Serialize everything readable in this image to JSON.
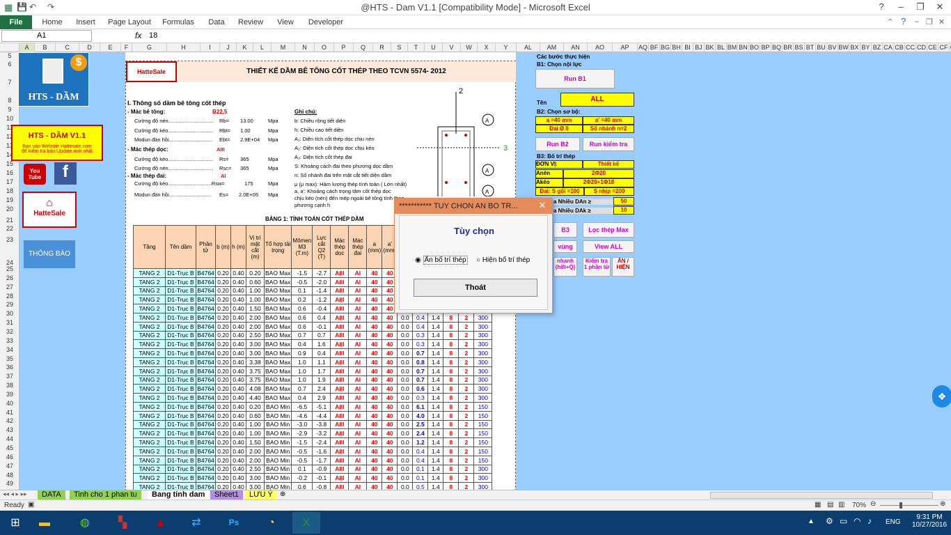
{
  "window": {
    "title": "@HTS - Dam V1.1  [Compatibility Mode] - Microsoft Excel"
  },
  "ribbon": {
    "file": "File",
    "tabs": [
      "Home",
      "Insert",
      "Page Layout",
      "Formulas",
      "Data",
      "Review",
      "View",
      "Developer"
    ]
  },
  "formula": {
    "cell": "A1",
    "fx": "fx",
    "value": "18"
  },
  "columns": [
    "A",
    "B",
    "C",
    "D",
    "E",
    "F",
    "G",
    "H",
    "I",
    "J",
    "K",
    "L",
    "M",
    "N",
    "O",
    "P",
    "Q",
    "R",
    "S",
    "T",
    "U",
    "V",
    "W",
    "X",
    "Y",
    "AL",
    "AM",
    "AN",
    "AO",
    "AP",
    "AQ",
    "BF",
    "BG",
    "BH",
    "BI",
    "BJ",
    "BK",
    "BL",
    "BM",
    "BN",
    "BO",
    "BP",
    "BQ",
    "BR",
    "BS",
    "BT",
    "BU",
    "BV",
    "BW",
    "BX",
    "BY",
    "BZ",
    "CA",
    "CB",
    "CC",
    "CD",
    "CE",
    "CF",
    "CG"
  ],
  "left": {
    "logo": "HTS - DẦM",
    "version": "HTS - DẦM V1.1",
    "note1": "Bạn vào Webstie Hattesale.com",
    "note2": "để kiểm tra bản Update mới nhất",
    "youtube": "You Tube",
    "fb": "f",
    "hatte": "HatteSale",
    "notice": "THÔNG BÁO"
  },
  "sheet": {
    "header_logo": "HatteSale",
    "title": "THIẾT KẾ DẦM BÊ TÔNG CỐT THÉP THEO TCVN 5574- 2012",
    "sec1": "I. Thông số dầm bê tông cốt thép",
    "concrete_label": "- Mác bê tông:",
    "concrete_val": "B22,5",
    "rb": "Cường độ nén...............................",
    "rb_k": "Rb=",
    "rb_v": "13.00",
    "rb_u": "Mpa",
    "rbt": "Cường độ kéo...............................",
    "rbt_k": "Rbt=",
    "rbt_v": "1.00",
    "rbt_u": "Mpa",
    "eb": "Modun đàn hồi..............................",
    "eb_k": "Ebt=",
    "eb_v": "2.9E+04",
    "eb_u": "Mpa",
    "long_label": "- Mác thép dọc:",
    "long_val": "AIII",
    "rs": "Cường độ kéo...............................",
    "rs_k": "Rs=",
    "rs_v": "365",
    "rs_u": "Mpa",
    "rsc": "Cường độ nén...............................",
    "rsc_k": "Rsc=",
    "rsc_v": "365",
    "rsc_u": "Mpa",
    "stir_label": "- Mác thép đai:",
    "stir_val": "AI",
    "rsw": "Cường độ kéo..............................Rsw=",
    "rsw_v": "175",
    "rsw_u": "Mpa",
    "es": "Modun đàn hồi.............................",
    "es_k": "Es=",
    "es_v": "2.0E+05",
    "es_u": "Mpa",
    "note_title": "Ghi chú:",
    "notes": [
      "b: Chiều rộng tiết diện",
      "h: Chiều cao tiết diện",
      "A₁: Diện tích cốt thép dọc chịu nén",
      "A₂: Diện tích cốt thép dọc chịu kéo",
      "A₃: Diện tích cốt thép đai",
      "S: Khoảng cách đai theo phương dọc dầm",
      "n: Số nhánh đai trên mặt cắt tiết diện dầm",
      "μ (μ max): Hàm lượng thép tính toán ( Lớn nhất)",
      "a, a': Khoảng cách trọng tâm cốt thép dọc",
      "chịu kéo (nén)  đến mép ngoài bê tông tính theo",
      "phương cạnh h"
    ],
    "table_title": "BẢNG 1: TÍNH TOÁN CỐT THÉP DẦM",
    "headers": [
      "Tầng",
      "Tên dầm",
      "Phần tử",
      "b (m)",
      "h (m)",
      "Vị trí mặt cắt (m)",
      "Tổ hợp tải trọng",
      "Mômen M3 (T.m)",
      "Lực cắt Q2 (T)",
      "Mác thép dọc",
      "Mác thép đai",
      "a (mm)",
      "a' (mm)",
      "",
      "",
      "",
      "",
      "",
      ""
    ]
  },
  "rows": [
    [
      "24",
      "",
      "",
      "",
      "",
      "",
      "",
      "",
      "",
      "",
      "",
      "",
      "",
      "",
      "",
      "",
      "",
      "",
      ""
    ],
    [
      "25",
      "TANG 2",
      "D1-Trục B",
      "B4764",
      "0.20",
      "0.40",
      "0.20",
      "BAO Max",
      "-1.5",
      "-2.7",
      "AIII",
      "AI",
      "40",
      "40",
      "0.0",
      "0.4",
      "1.4",
      "8",
      "2",
      "300"
    ],
    [
      "26",
      "TANG 2",
      "D1-Trục B",
      "B4764",
      "0.20",
      "0.40",
      "0.60",
      "BAO Max",
      "-0.5",
      "-2.0",
      "AIII",
      "AI",
      "40",
      "40",
      "0.0",
      "0.4",
      "1.4",
      "8",
      "2",
      "300"
    ],
    [
      "27",
      "TANG 2",
      "D1-Trục B",
      "B4764",
      "0.20",
      "0.40",
      "1.00",
      "BAO Max",
      "0.1",
      "-1.4",
      "AIII",
      "AI",
      "40",
      "40",
      "0.0",
      "0.4",
      "1.4",
      "8",
      "2",
      "300"
    ],
    [
      "28",
      "TANG 2",
      "D1-Trục B",
      "B4764",
      "0.20",
      "0.40",
      "1.00",
      "BAO Max",
      "0.2",
      "-1.2",
      "AIII",
      "AI",
      "40",
      "40",
      "0.0",
      "0.4",
      "1.4",
      "8",
      "2",
      "300"
    ],
    [
      "29",
      "TANG 2",
      "D1-Trục B",
      "B4764",
      "0.20",
      "0.40",
      "1.50",
      "BAO Max",
      "0.6",
      "-0.4",
      "AIII",
      "AI",
      "40",
      "40",
      "0.0",
      "0.4",
      "1.4",
      "8",
      "2",
      "300"
    ],
    [
      "30",
      "TANG 2",
      "D1-Trục B",
      "B4764",
      "0.20",
      "0.40",
      "2.00",
      "BAO Max",
      "0.6",
      "0.4",
      "AIII",
      "AI",
      "40",
      "40",
      "0.0",
      "0.4",
      "1.4",
      "8",
      "2",
      "300"
    ],
    [
      "31",
      "TANG 2",
      "D1-Trục B",
      "B4764",
      "0.20",
      "0.40",
      "2.00",
      "BAO Max",
      "0.6",
      "-0.1",
      "AIII",
      "AI",
      "40",
      "40",
      "0.0",
      "0.4",
      "1.4",
      "8",
      "2",
      "300"
    ],
    [
      "32",
      "TANG 2",
      "D1-Trục B",
      "B4764",
      "0.20",
      "0.40",
      "2.50",
      "BAO Max",
      "0.7",
      "0.7",
      "AIII",
      "AI",
      "40",
      "40",
      "0.0",
      "0.3",
      "1.4",
      "8",
      "2",
      "300"
    ],
    [
      "33",
      "TANG 2",
      "D1-Trục B",
      "B4764",
      "0.20",
      "0.40",
      "3.00",
      "BAO Max",
      "0.4",
      "1.6",
      "AIII",
      "AI",
      "40",
      "40",
      "0.0",
      "0.3",
      "1.4",
      "8",
      "2",
      "300"
    ],
    [
      "34",
      "TANG 2",
      "D1-Trục B",
      "B4764",
      "0.20",
      "0.40",
      "3.00",
      "BAO Max",
      "0.9",
      "0.4",
      "AIII",
      "AI",
      "40",
      "40",
      "0.0",
      "0.7",
      "1.4",
      "8",
      "2",
      "300"
    ],
    [
      "35",
      "TANG 2",
      "D1-Trục B",
      "B4764",
      "0.20",
      "0.40",
      "3.38",
      "BAO Max",
      "1.0",
      "1.1",
      "AIII",
      "AI",
      "40",
      "40",
      "0.0",
      "0.8",
      "1.4",
      "8",
      "2",
      "300"
    ],
    [
      "36",
      "TANG 2",
      "D1-Trục B",
      "B4764",
      "0.20",
      "0.40",
      "3.75",
      "BAO Max",
      "1.0",
      "1.7",
      "AIII",
      "AI",
      "40",
      "40",
      "0.0",
      "0.7",
      "1.4",
      "8",
      "2",
      "300"
    ],
    [
      "37",
      "TANG 2",
      "D1-Trục B",
      "B4764",
      "0.20",
      "0.40",
      "3.75",
      "BAO Max",
      "1.0",
      "1.9",
      "AIII",
      "AI",
      "40",
      "40",
      "0.0",
      "0.7",
      "1.4",
      "8",
      "2",
      "300"
    ],
    [
      "38",
      "TANG 2",
      "D1-Trục B",
      "B4764",
      "0.20",
      "0.40",
      "4.08",
      "BAO Max",
      "0.7",
      "2.4",
      "AIII",
      "AI",
      "40",
      "40",
      "0.0",
      "0.6",
      "1.4",
      "8",
      "2",
      "300"
    ],
    [
      "39",
      "TANG 2",
      "D1-Trục B",
      "B4764",
      "0.20",
      "0.40",
      "4.40",
      "BAO Max",
      "0.4",
      "2.9",
      "AIII",
      "AI",
      "40",
      "40",
      "0.0",
      "0.3",
      "1.4",
      "8",
      "2",
      "300"
    ],
    [
      "40",
      "TANG 2",
      "D1-Trục B",
      "B4764",
      "0.20",
      "0.40",
      "0.20",
      "BAO Min",
      "-6.5",
      "-5.1",
      "AIII",
      "AI",
      "40",
      "40",
      "0.0",
      "6.1",
      "1.4",
      "8",
      "2",
      "150"
    ],
    [
      "41",
      "TANG 2",
      "D1-Trục B",
      "B4764",
      "0.20",
      "0.40",
      "0.60",
      "BAO Min",
      "-4.6",
      "-4.4",
      "AIII",
      "AI",
      "40",
      "40",
      "0.0",
      "4.0",
      "1.4",
      "8",
      "2",
      "150"
    ],
    [
      "42",
      "TANG 2",
      "D1-Trục B",
      "B4764",
      "0.20",
      "0.40",
      "1.00",
      "BAO Min",
      "-3.0",
      "-3.8",
      "AIII",
      "AI",
      "40",
      "40",
      "0.0",
      "2.5",
      "1.4",
      "8",
      "2",
      "150"
    ],
    [
      "43",
      "TANG 2",
      "D1-Trục B",
      "B4764",
      "0.20",
      "0.40",
      "1.00",
      "BAO Min",
      "-2.9",
      "-3.2",
      "AIII",
      "AI",
      "40",
      "40",
      "0.0",
      "2.4",
      "1.4",
      "8",
      "2",
      "150"
    ],
    [
      "44",
      "TANG 2",
      "D1-Trục B",
      "B4764",
      "0.20",
      "0.40",
      "1.50",
      "BAO Min",
      "-1.5",
      "-2.4",
      "AIII",
      "AI",
      "40",
      "40",
      "0.0",
      "1.2",
      "1.4",
      "8",
      "2",
      "150"
    ],
    [
      "45",
      "TANG 2",
      "D1-Trục B",
      "B4764",
      "0.20",
      "0.40",
      "2.00",
      "BAO Min",
      "-0.5",
      "-1.6",
      "AIII",
      "AI",
      "40",
      "40",
      "0.0",
      "0.4",
      "1.4",
      "8",
      "2",
      "150"
    ],
    [
      "46",
      "TANG 2",
      "D1-Trục B",
      "B4764",
      "0.20",
      "0.40",
      "2.00",
      "BAO Min",
      "-0.5",
      "-1.7",
      "AIII",
      "AI",
      "40",
      "40",
      "0.0",
      "0.4",
      "1.4",
      "8",
      "2",
      "150"
    ],
    [
      "47",
      "TANG 2",
      "D1-Trục B",
      "B4764",
      "0.20",
      "0.40",
      "2.50",
      "BAO Min",
      "0.1",
      "-0.9",
      "AIII",
      "AI",
      "40",
      "40",
      "0.0",
      "0.1",
      "1.4",
      "8",
      "2",
      "300"
    ],
    [
      "48",
      "TANG 2",
      "D1-Trục B",
      "B4764",
      "0.20",
      "0.40",
      "3.00",
      "BAO Min",
      "-0.2",
      "-0.1",
      "AIII",
      "AI",
      "40",
      "40",
      "0.0",
      "0.1",
      "1.4",
      "8",
      "2",
      "300"
    ],
    [
      "49",
      "TANG 2",
      "D1-Trục B",
      "B4764",
      "0.20",
      "0.40",
      "3.00",
      "BAO Min",
      "0.6",
      "-0.8",
      "AIII",
      "AI",
      "40",
      "40",
      "0.0",
      "0.5",
      "1.4",
      "8",
      "2",
      "300"
    ]
  ],
  "right": {
    "steps": "Các bước thực hiện",
    "b1": "B1: Chọn nội lực",
    "runb1": "Run B1",
    "ten": "Tên",
    "all": "ALL",
    "b2": "B2: Chọn sơ bộ:",
    "a": "a =40 mm",
    "a2": "a' =40 mm",
    "dai": "Đai Ø 8",
    "nhanh": "Số nhánh n=2",
    "runb2": "Run B2",
    "runkt": "Run kiểm tra",
    "b3": "B3: Bố trí thép",
    "dvvi": "ĐƠN VỊ:",
    "tk": "Thiết kế",
    "anen": "Anén",
    "anen_v": "2Φ20",
    "akeo": "Akéo",
    "akeo_v": "2Φ20+1Φ18",
    "dai_s": "Đai: S gối =100",
    "dai_n": "S nhịp =200",
    "dan": "a Nhiều  DAn ≥",
    "dan_v": "50",
    "dak": "a Nhiều  DAk ≥",
    "dak_v": "10",
    "btn_b3": "B3",
    "btn_loc": "Lọc thép Max",
    "btn_vung": "vùng",
    "btn_view": "View ALL",
    "btn_nhanh": "nhanh (hift+Q)",
    "btn_kt": "Kiểm tra 1 phần tử",
    "btn_an": "ẨN / HIỆN"
  },
  "dialog": {
    "title": "*********** TUY CHON AN BO TR...",
    "close": "✕",
    "heading": "Tùy chọn",
    "opt1": "Ẩn bố trí thép",
    "opt2": "Hiện  bố trí thép",
    "exit": "Thoát"
  },
  "sheettabs": [
    "DATA",
    "Tinh cho 1 phan tu",
    "Bang tinh dam",
    "Sheet1",
    "LƯU Ý"
  ],
  "status": {
    "ready": "Ready",
    "zoom": "70%"
  },
  "taskbar": {
    "lang": "ENG",
    "time": "9:31 PM",
    "date": "10/27/2016"
  }
}
